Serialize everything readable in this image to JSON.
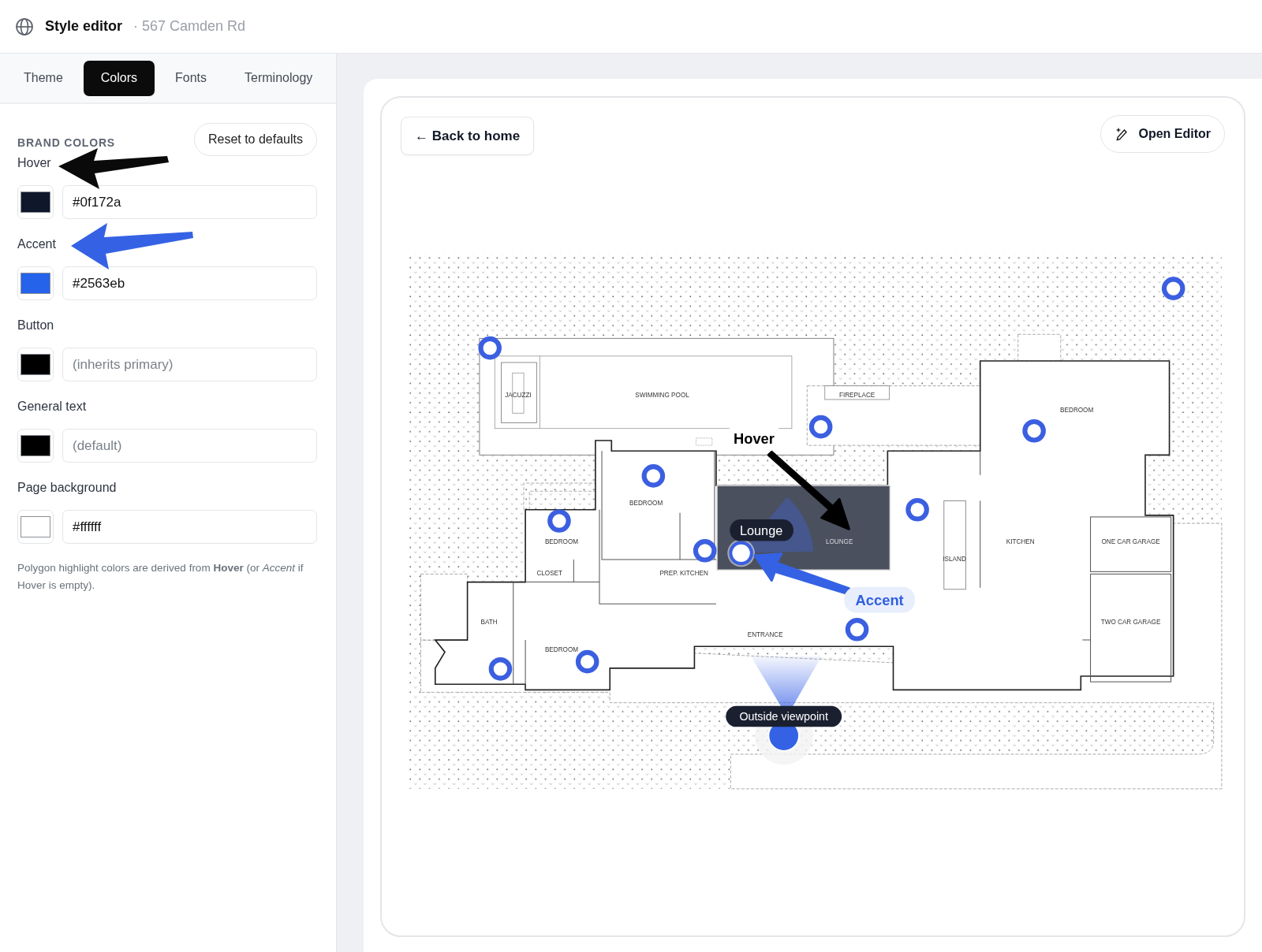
{
  "header": {
    "title": "Style editor",
    "subtitle": "· 567 Camden Rd"
  },
  "tabs": [
    {
      "label": "Theme",
      "selected": false
    },
    {
      "label": "Colors",
      "selected": true
    },
    {
      "label": "Fonts",
      "selected": false
    },
    {
      "label": "Terminology",
      "selected": false
    }
  ],
  "section": {
    "title": "BRAND COLORS",
    "reset_button": "Reset to defaults"
  },
  "colors": [
    {
      "label": "Hover",
      "color": "#0f172a",
      "value": "#0f172a"
    },
    {
      "label": "Accent",
      "color": "#2563eb",
      "value": "#2563eb"
    },
    {
      "label": "Button",
      "color": "#000000",
      "placeholder": "(inherits primary)"
    },
    {
      "label": "General text",
      "color": "#000000",
      "placeholder": "(default)"
    },
    {
      "label": "Page background",
      "color": "#ffffff",
      "value": "#ffffff"
    }
  ],
  "note": "Polygon highlight colors are derived from **Hover** (or *Accent* if Hover is empty).",
  "preview": {
    "back_button": "← Back to home",
    "editor_button": "Open Editor"
  },
  "floor_plan": {
    "rooms": [
      "JACUZZI",
      "SWIMMING POOL",
      "FIREPLACE",
      "BEDROOM",
      "BEDROOM",
      "BEDROOM",
      "LOUNGE",
      "KITCHEN",
      "ONE CAR GARAGE",
      "ISLAND",
      "CLOSET",
      "PREP. KITCHEN",
      "BATH",
      "TWO CAR GARAGE",
      "ENTRANCE",
      "BEDROOM"
    ],
    "hotspots": [
      {
        "selected": false
      },
      {
        "selected": false
      },
      {
        "selected": false
      },
      {
        "selected": false
      },
      {
        "selected": false
      },
      {
        "selected": false
      },
      {
        "selected": false
      },
      {
        "selected": false
      },
      {
        "selected": true
      },
      {
        "selected": false
      },
      {
        "selected": false
      },
      {
        "selected": false
      }
    ],
    "room_tooltip": "Lounge",
    "viewpoint_tooltip": "Outside viewpoint",
    "hover_callout": "Hover",
    "accent_callout": "Accent"
  }
}
